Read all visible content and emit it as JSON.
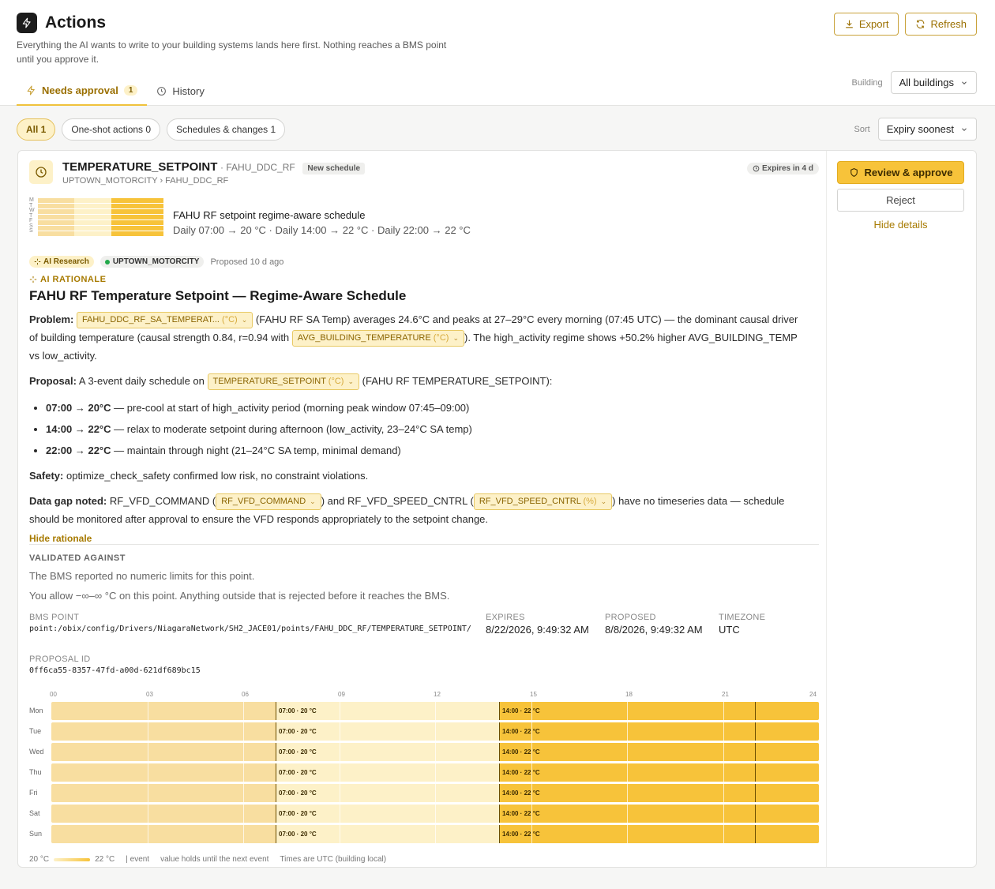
{
  "header": {
    "title": "Actions",
    "subtitle": "Everything the AI wants to write to your building systems lands here first. Nothing reaches a BMS point until you approve it.",
    "export_label": "Export",
    "refresh_label": "Refresh"
  },
  "tabs": [
    {
      "label": "Needs approval",
      "count": "1"
    },
    {
      "label": "History"
    }
  ],
  "building": {
    "label": "Building",
    "value": "All buildings"
  },
  "filters": [
    {
      "label": "All 1"
    },
    {
      "label": "One-shot actions 0"
    },
    {
      "label": "Schedules & changes 1"
    }
  ],
  "sort": {
    "label": "Sort",
    "value": "Expiry soonest"
  },
  "card": {
    "point_name": "TEMPERATURE_SETPOINT",
    "point_sub": "· FAHU_DDC_RF",
    "badge": "New schedule",
    "breadcrumb": "UPTOWN_MOTORCITY › FAHU_DDC_RF",
    "expires_badge": "Expires in 4 d",
    "mini_days": [
      "M",
      "T",
      "W",
      "T",
      "F",
      "S",
      "S"
    ],
    "schedule_title": "FAHU RF setpoint regime-aware schedule",
    "schedule_desc": "Daily 07:00 → 20 °C · Daily 14:00 → 22 °C · Daily 22:00 → 22 °C",
    "tag_ai": "AI Research",
    "tag_building": "UPTOWN_MOTORCITY",
    "proposed_ago": "Proposed 10 d ago",
    "rationale_label": "AI RATIONALE",
    "rationale_title": "FAHU RF Temperature Setpoint — Regime-Aware Schedule",
    "problem": {
      "label": "Problem:",
      "pill1": "FAHU_DDC_RF_SA_TEMPERAT...",
      "pill1_unit": "(°C)",
      "text1": "(FAHU RF SA Temp) averages 24.6°C and peaks at 27–29°C every morning (07:45 UTC) — the dominant causal driver of building temperature (causal strength 0.84, r=0.94 with",
      "pill2": "AVG_BUILDING_TEMPERATURE",
      "pill2_unit": "(°C)",
      "text2": "). The high_activity regime shows +50.2% higher AVG_BUILDING_TEMP vs low_activity."
    },
    "proposal": {
      "label": "Proposal:",
      "text1": "A 3-event daily schedule on",
      "pill": "TEMPERATURE_SETPOINT",
      "pill_unit": "(°C)",
      "text2": "(FAHU RF TEMPERATURE_SETPOINT):"
    },
    "bullets": [
      {
        "bold": "07:00 → 20°C",
        "text": "— pre-cool at start of high_activity period (morning peak window 07:45–09:00)"
      },
      {
        "bold": "14:00 → 22°C",
        "text": "— relax to moderate setpoint during afternoon (low_activity, 23–24°C SA temp)"
      },
      {
        "bold": "22:00 → 22°C",
        "text": "— maintain through night (21–24°C SA temp, minimal demand)"
      }
    ],
    "safety": {
      "label": "Safety:",
      "text": "optimize_check_safety confirmed low risk, no constraint violations."
    },
    "datagap": {
      "label": "Data gap noted:",
      "text1": "RF_VFD_COMMAND (",
      "pill1": "RF_VFD_COMMAND",
      "text2": ") and RF_VFD_SPEED_CNTRL (",
      "pill2": "RF_VFD_SPEED_CNTRL",
      "pill2_unit": "(%)",
      "text3": ") have no timeseries data — schedule should be monitored after approval to ensure the VFD responds appropriately to the setpoint change."
    },
    "hide_rationale": "Hide rationale",
    "validated_label": "VALIDATED AGAINST",
    "validated_1": "The BMS reported no numeric limits for this point.",
    "validated_2": "You allow −∞–∞ °C on this point. Anything outside that is rejected before it reaches the BMS.",
    "bms_point_label": "BMS POINT",
    "bms_point": "point:/obix/config/Drivers/NiagaraNetwork/SH2_JACE01/points/FAHU_DDC_RF/TEMPERATURE_SETPOINT/",
    "expires_label": "EXPIRES",
    "expires": "8/22/2026, 9:49:32 AM",
    "proposed_label": "PROPOSED",
    "proposed": "8/8/2026, 9:49:32 AM",
    "timezone_label": "TIMEZONE",
    "timezone": "UTC",
    "proposal_id_label": "PROPOSAL ID",
    "proposal_id": "0ff6ca55-8357-47fd-a00d-621df689bc15"
  },
  "side": {
    "approve_label": "Review & approve",
    "reject_label": "Reject",
    "hide_details_label": "Hide details"
  },
  "schedule_grid": {
    "hour_ticks": [
      "00",
      "03",
      "06",
      "09",
      "12",
      "15",
      "18",
      "21",
      "24"
    ],
    "days": [
      "Mon",
      "Tue",
      "Wed",
      "Thu",
      "Fri",
      "Sat",
      "Sun"
    ],
    "events": [
      {
        "hour": 7,
        "value": 20,
        "label": "07:00 · 20 °C"
      },
      {
        "hour": 14,
        "value": 22,
        "label": "14:00 · 22 °C"
      },
      {
        "hour": 22,
        "value": 22,
        "label": ""
      }
    ],
    "value_min": 20,
    "value_max": 22,
    "colors": {
      "low": "#fdf1c8",
      "high": "#f7c33a",
      "held": "#f8dea0"
    }
  },
  "legend": {
    "min_label": "20 °C",
    "max_label": "22 °C",
    "event_label": "| event",
    "holds_label": "value holds until the next event",
    "tz_label": "Times are UTC (building local)"
  }
}
